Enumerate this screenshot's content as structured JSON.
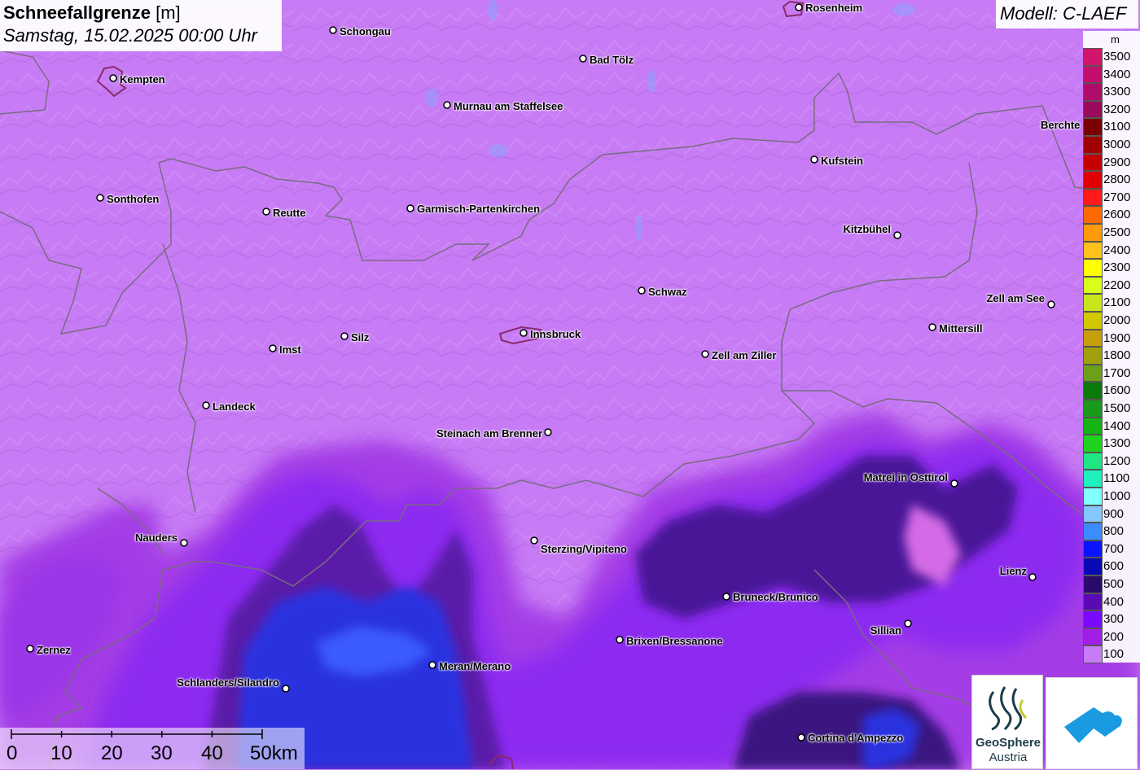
{
  "title": {
    "main": "Schneefallgrenze",
    "unit": "[m]",
    "date": "Samstag, 15.02.2025 00:00 Uhr"
  },
  "model": "Modell: C-LAEF",
  "legend": {
    "unit": "m",
    "items": [
      {
        "label": "3500",
        "color": "#d1156b"
      },
      {
        "label": "3400",
        "color": "#c20f6b"
      },
      {
        "label": "3300",
        "color": "#b00c6c"
      },
      {
        "label": "3200",
        "color": "#9a0a5c"
      },
      {
        "label": "3100",
        "color": "#7a0000"
      },
      {
        "label": "3000",
        "color": "#a00000"
      },
      {
        "label": "2900",
        "color": "#c40000"
      },
      {
        "label": "2800",
        "color": "#e00000"
      },
      {
        "label": "2700",
        "color": "#ff1a1a"
      },
      {
        "label": "2600",
        "color": "#ff6a00"
      },
      {
        "label": "2500",
        "color": "#ff9a0a"
      },
      {
        "label": "2400",
        "color": "#ffc21a"
      },
      {
        "label": "2300",
        "color": "#ffff00"
      },
      {
        "label": "2200",
        "color": "#d8ff1a"
      },
      {
        "label": "2100",
        "color": "#c8e619"
      },
      {
        "label": "2000",
        "color": "#d1c800"
      },
      {
        "label": "1900",
        "color": "#c6a00a"
      },
      {
        "label": "1800",
        "color": "#a0a00a"
      },
      {
        "label": "1700",
        "color": "#6aa01a"
      },
      {
        "label": "1600",
        "color": "#0a7a0a"
      },
      {
        "label": "1500",
        "color": "#1a9a1a"
      },
      {
        "label": "1400",
        "color": "#14b414"
      },
      {
        "label": "1300",
        "color": "#1ed21e"
      },
      {
        "label": "1200",
        "color": "#1ee682"
      },
      {
        "label": "1100",
        "color": "#1ef0be"
      },
      {
        "label": "1000",
        "color": "#82ffff"
      },
      {
        "label": "900",
        "color": "#82c8ff"
      },
      {
        "label": "800",
        "color": "#3c8cff"
      },
      {
        "label": "700",
        "color": "#0a14ff"
      },
      {
        "label": "600",
        "color": "#0a0ab4"
      },
      {
        "label": "500",
        "color": "#2a0a6a"
      },
      {
        "label": "400",
        "color": "#5a0ab4"
      },
      {
        "label": "300",
        "color": "#7a0aff"
      },
      {
        "label": "200",
        "color": "#a01ee6"
      },
      {
        "label": "100",
        "color": "#c77cf5"
      }
    ]
  },
  "cities": [
    {
      "name": "Rosenheim"
    },
    {
      "name": "Schongau"
    },
    {
      "name": "Kempten"
    },
    {
      "name": "Bad Tölz"
    },
    {
      "name": "Murnau am Staffelsee"
    },
    {
      "name": "Berchte"
    },
    {
      "name": "Kufstein"
    },
    {
      "name": "Sonthofen"
    },
    {
      "name": "Reutte"
    },
    {
      "name": "Garmisch-Partenkirchen"
    },
    {
      "name": "Kitzbühel"
    },
    {
      "name": "Schwaz"
    },
    {
      "name": "Zell am See"
    },
    {
      "name": "Mittersill"
    },
    {
      "name": "Silz"
    },
    {
      "name": "Innsbruck"
    },
    {
      "name": "Imst"
    },
    {
      "name": "Zell am Ziller"
    },
    {
      "name": "Landeck"
    },
    {
      "name": "Steinach am Brenner"
    },
    {
      "name": "Matrei in Osttirol"
    },
    {
      "name": "Nauders"
    },
    {
      "name": "Sterzing/Vipiteno"
    },
    {
      "name": "Lienz"
    },
    {
      "name": "Bruneck/Brunico"
    },
    {
      "name": "Sillian"
    },
    {
      "name": "Brixen/Bressanone"
    },
    {
      "name": "Zernez"
    },
    {
      "name": "Meran/Merano"
    },
    {
      "name": "Schlanders/Silandro"
    },
    {
      "name": "Cortina d'Ampezzo"
    }
  ],
  "scale": {
    "labels": [
      "0",
      "10",
      "20",
      "30",
      "40",
      "50km"
    ]
  },
  "logos": {
    "geosphere_line1": "GeoSphere",
    "geosphere_line2": "Austria"
  }
}
